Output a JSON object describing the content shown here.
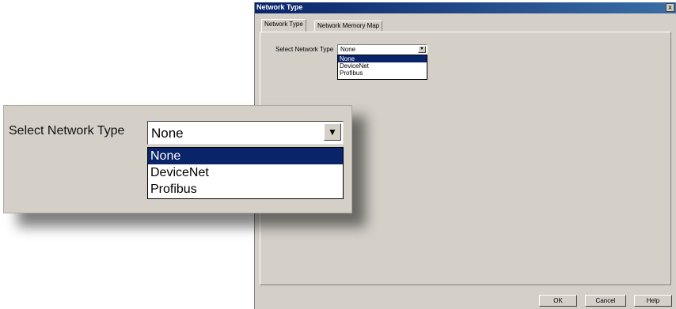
{
  "dialog": {
    "title": "Network Type",
    "close_label": "x",
    "tabs": [
      {
        "label": "Network Type",
        "active": true
      },
      {
        "label": "Network Memory Map",
        "active": false
      }
    ],
    "select_label": "Select Network Type",
    "select_value": "None",
    "options": [
      "None",
      "DeviceNet",
      "Profibus"
    ],
    "selected_option": "None",
    "buttons": {
      "ok": "OK",
      "cancel": "Cancel",
      "help": "Help"
    }
  },
  "zoom": {
    "select_label": "Select Network Type",
    "select_value": "None",
    "options": [
      "None",
      "DeviceNet",
      "Profibus"
    ]
  },
  "icons": {
    "dropdown_arrow": "chevron-down-icon",
    "close": "close-icon"
  },
  "colors": {
    "selection": "#0a246a",
    "face": "#d4d0c8",
    "title_start": "#0a246a"
  }
}
